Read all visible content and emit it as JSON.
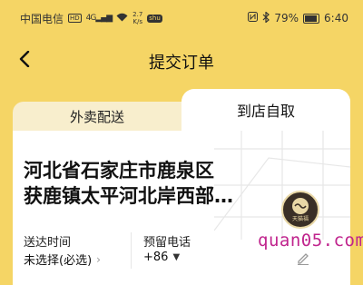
{
  "status_bar": {
    "carrier": "中国电信",
    "hd": "HD",
    "signal": "4G",
    "speed_value": "2.7",
    "speed_unit": "K/s",
    "app_badge": "shu",
    "battery_percent": "79%",
    "time": "6:40"
  },
  "nav": {
    "title": "提交订单"
  },
  "tabs": {
    "delivery": "外卖配送",
    "pickup": "到店自取"
  },
  "store": {
    "address_line1": "河北省石家庄市鹿泉区",
    "address_line2": "获鹿镇太平河北岸西部…",
    "logo_text": "天猫福"
  },
  "form": {
    "delivery_time_label": "送达时间",
    "delivery_time_value": "未选择(必选)",
    "phone_label": "预留电话",
    "phone_code": "+86"
  },
  "watermark": "quan05.com"
}
